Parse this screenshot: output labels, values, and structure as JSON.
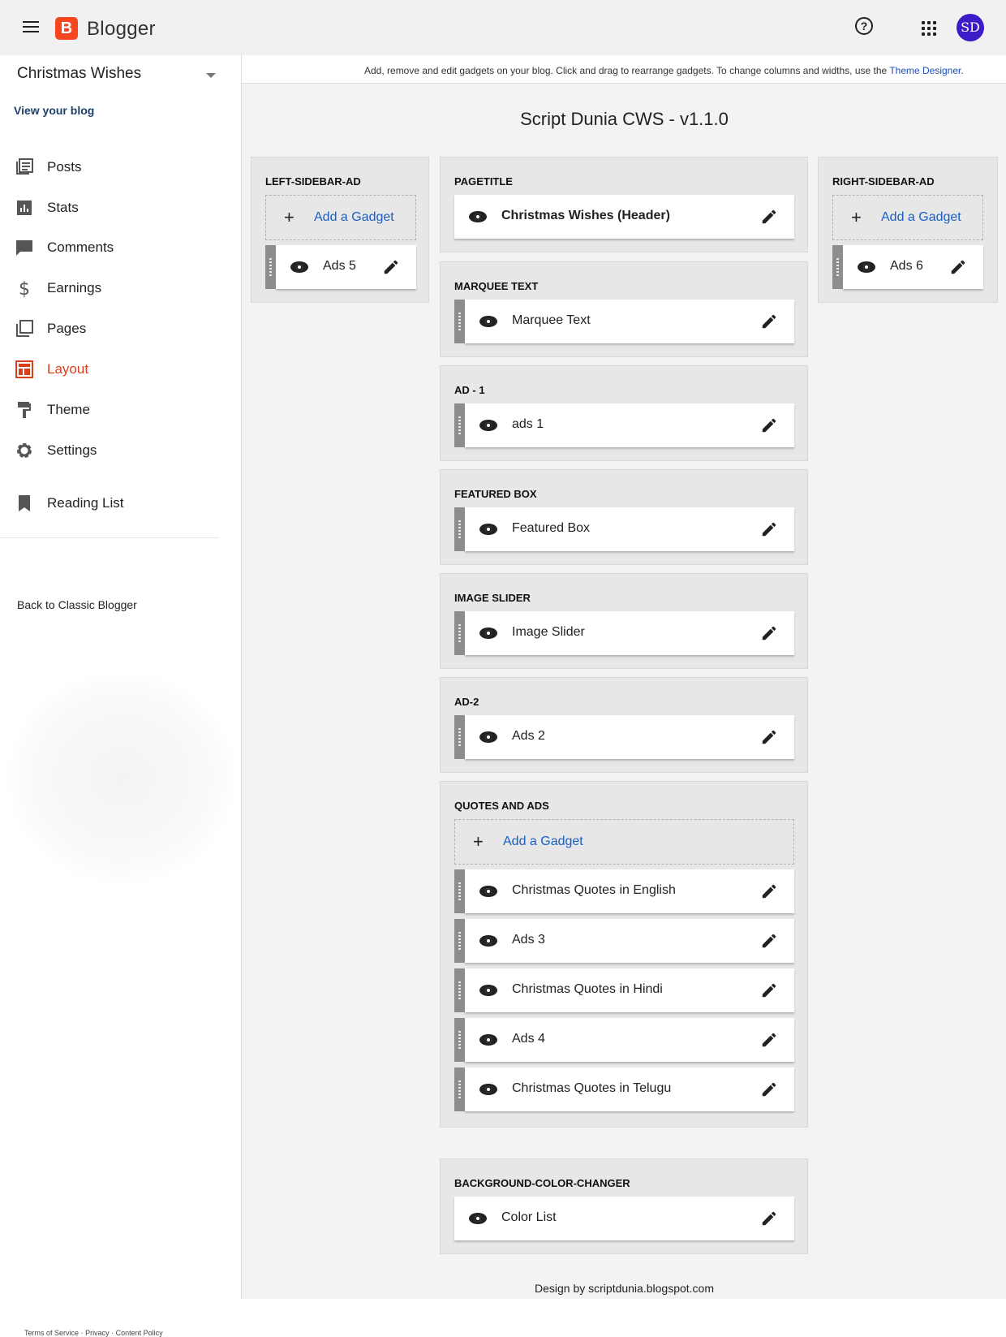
{
  "app": {
    "logo_letter": "B",
    "name": "Blogger",
    "help_glyph": "?",
    "avatar_initials": "SD"
  },
  "sidebar": {
    "blog_name": "Christmas Wishes",
    "view_blog": "View your blog",
    "items": [
      {
        "label": "Posts",
        "icon": "posts-icon"
      },
      {
        "label": "Stats",
        "icon": "stats-icon"
      },
      {
        "label": "Comments",
        "icon": "comments-icon"
      },
      {
        "label": "Earnings",
        "icon": "dollar-icon"
      },
      {
        "label": "Pages",
        "icon": "pages-icon"
      },
      {
        "label": "Layout",
        "icon": "layout-icon",
        "active": true
      },
      {
        "label": "Theme",
        "icon": "paint-roller-icon"
      },
      {
        "label": "Settings",
        "icon": "gear-icon"
      }
    ],
    "reading_list": "Reading List",
    "classic": "Back to Classic Blogger",
    "footer": {
      "terms": "Terms of Service",
      "privacy": "Privacy",
      "content": "Content Policy",
      "sep": "·"
    }
  },
  "main": {
    "info_text": "Add, remove and edit gadgets on your blog. Click and drag to rearrange gadgets. To change columns and widths, use the ",
    "info_link": "Theme Designer",
    "info_end": ".",
    "template_title": "Script Dunia CWS - v1.1.0",
    "design_by": "Design by scriptdunia.blogspot.com",
    "add_gadget": "Add a Gadget",
    "plus": "+",
    "sections": {
      "left": {
        "title": "LEFT-SIDEBAR-AD",
        "gadgets": [
          "Ads 5"
        ]
      },
      "pagetitle": {
        "title": "PAGETITLE",
        "gadgets": [
          "Christmas Wishes (Header)"
        ]
      },
      "right": {
        "title": "RIGHT-SIDEBAR-AD",
        "gadgets": [
          "Ads 6"
        ]
      },
      "marquee": {
        "title": "MARQUEE TEXT",
        "gadgets": [
          "Marquee Text"
        ]
      },
      "ad1": {
        "title": "AD - 1",
        "gadgets": [
          "ads 1"
        ]
      },
      "featured": {
        "title": "FEATURED BOX",
        "gadgets": [
          "Featured Box"
        ]
      },
      "slider": {
        "title": "IMAGE SLIDER",
        "gadgets": [
          "Image Slider"
        ]
      },
      "ad2": {
        "title": "AD-2",
        "gadgets": [
          "Ads 2"
        ]
      },
      "quotes": {
        "title": "QUOTES AND ADS",
        "gadgets": [
          "Christmas Quotes in English",
          "Ads 3",
          "Christmas Quotes in Hindi",
          "Ads 4",
          "Christmas Quotes in Telugu"
        ]
      },
      "bgcolor": {
        "title": "BACKGROUND-COLOR-CHANGER",
        "gadgets": [
          "Color List"
        ]
      }
    }
  },
  "colors": {
    "accent_active": "#d93f1e",
    "link": "#1a5fc1",
    "logo": "#f5461f",
    "avatar": "#3d1bc9"
  }
}
